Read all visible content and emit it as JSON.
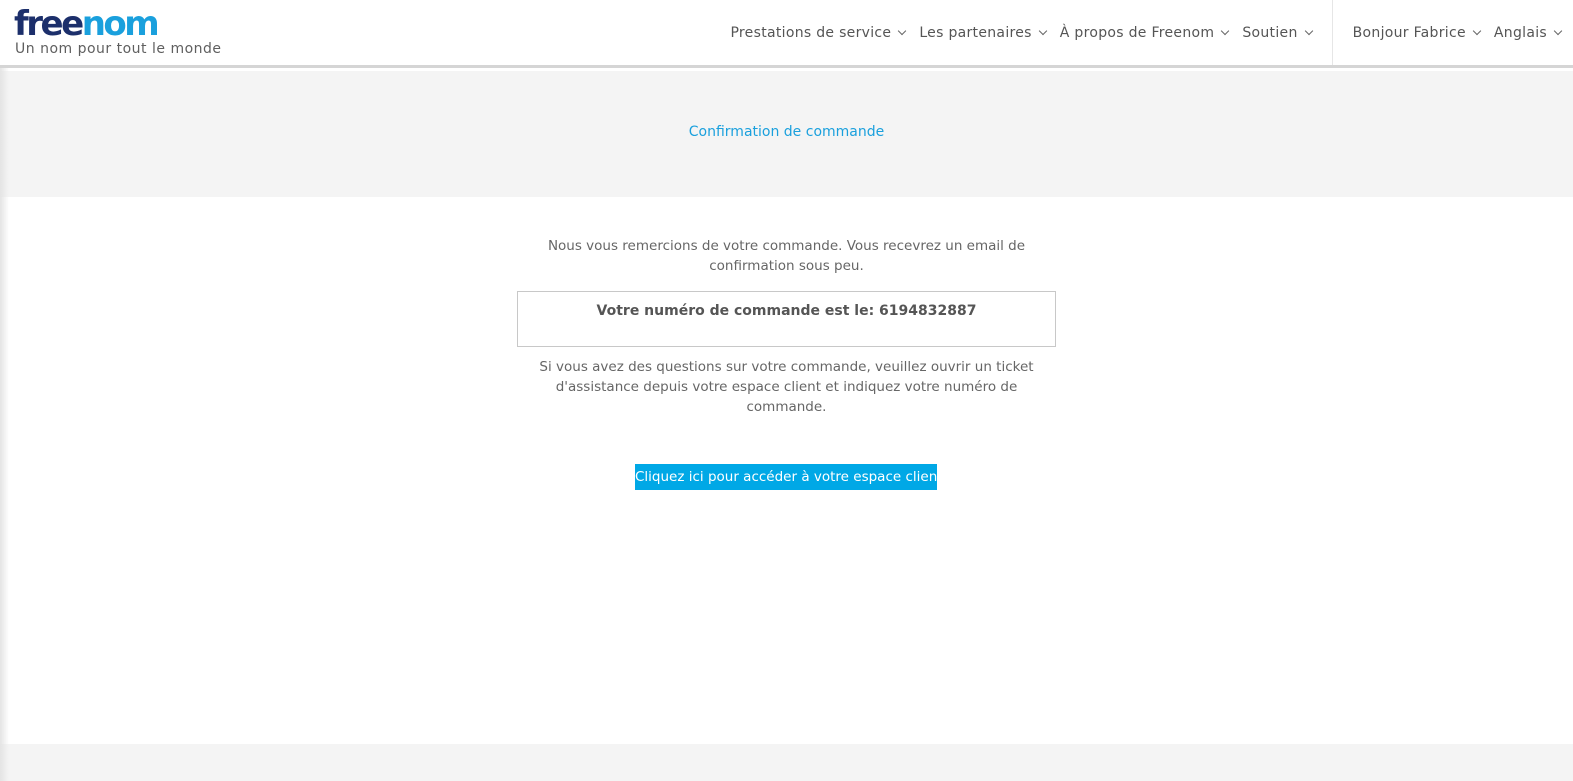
{
  "brand": {
    "logo_part1": "free",
    "logo_part2": "nom",
    "tagline": "Un nom pour tout le monde",
    "color_dark": "#1c2f6b",
    "color_blue": "#1aa0dd"
  },
  "nav": {
    "items": [
      {
        "label": "Prestations de service"
      },
      {
        "label": "Les partenaires"
      },
      {
        "label": "À propos de Freenom"
      },
      {
        "label": "Soutien"
      }
    ],
    "user": {
      "label": "Bonjour Fabrice"
    },
    "language": {
      "label": "Anglais"
    }
  },
  "page": {
    "title": "Confirmation de commande",
    "thanks_text": "Nous vous remercions de votre commande. Vous recevrez un email de confirmation sous peu.",
    "order_number_text": "Votre numéro de commande est le: 6194832887",
    "help_text": "Si vous avez des questions sur votre commande, veuillez ouvrir un ticket d'assistance depuis votre espace client et indiquez votre numéro de commande.",
    "cta_label": "Cliquez ici pour accéder à votre espace client"
  },
  "colors": {
    "accent": "#00a8e6",
    "band_bg": "#f4f4f4"
  }
}
